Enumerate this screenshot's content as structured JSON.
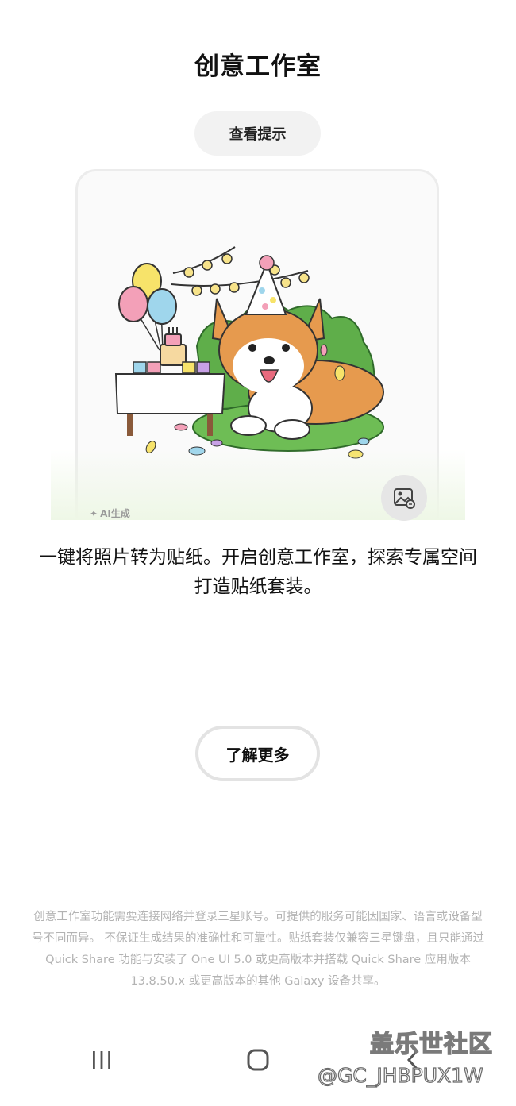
{
  "header": {
    "title": "创意工作室"
  },
  "tips_button": {
    "label": "查看提示"
  },
  "preview": {
    "ai_label": "AI生成"
  },
  "description": {
    "text": "一键将照片转为贴纸。开启创意工作室，探索专属空间打造贴纸套装。"
  },
  "learn_more_button": {
    "label": "了解更多"
  },
  "disclaimer": {
    "text": "创意工作室功能需要连接网络并登录三星账号。可提供的服务可能因国家、语言或设备型号不同而异。 不保证生成结果的准确性和可靠性。贴纸套装仅兼容三星键盘，且只能通过 Quick Share 功能与安装了 One UI 5.0 或更高版本并搭载 Quick Share 应用版本 13.8.50.x 或更高版本的其他 Galaxy 设备共享。"
  },
  "watermark": {
    "community": "盖乐世社区",
    "user_id": "@GC_JHBPUX1W"
  },
  "icons": [
    "sparkle-icon",
    "gallery-icon",
    "recent-apps-icon",
    "home-icon",
    "back-icon"
  ],
  "colors": {
    "background": "#ffffff",
    "pill_button": "#f2f2f2",
    "disclaimer_text": "#b3b3b3"
  }
}
